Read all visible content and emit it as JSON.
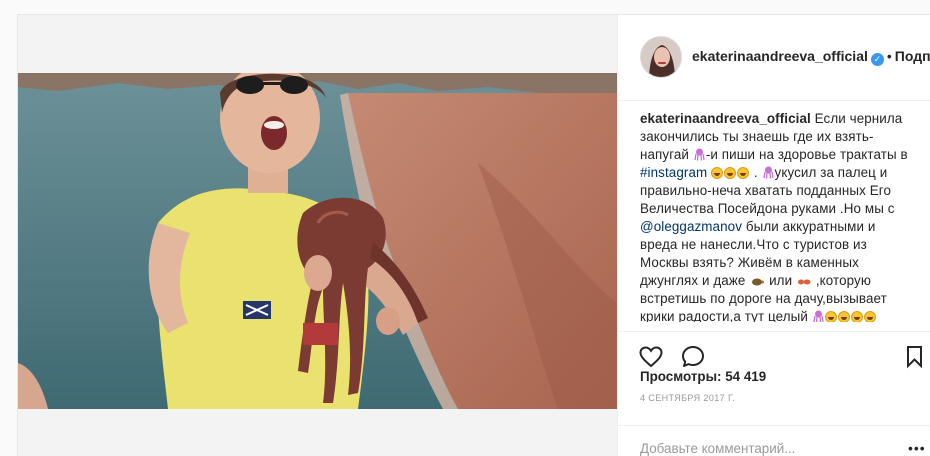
{
  "post": {
    "author": {
      "username": "ekaterinaandreeva_official",
      "verified": true,
      "separator": "•",
      "follow_label": "Подписаться",
      "follow_visible": "Подпи"
    },
    "caption": {
      "username": "ekaterinaandreeva_official",
      "part1": " Если чернила закончились ты знаешь где их взять-напугай ",
      "part2": "-и пиши на здоровье трактаты в ",
      "hashtag": "#instagram",
      "part3": " . ",
      "part4": "укусил за палец и правильно-неча хватать подданных Его Величества Посейдона руками .Но мы с ",
      "mention": "@oleggazmanov",
      "part5": " были аккуратными и вреда не нанесли.Что с туристов из Москвы взять? Живём в каменных джунглях и даже ",
      "part6": " или ",
      "part7": " ,которую встретишь по дороге на дачу,вызывает крики радости,а тут целый "
    },
    "views_label": "Просмотры:",
    "views_value": "54 419",
    "date": "4 СЕНТЯБРЯ 2017 Г.",
    "comment_placeholder": "Добавьте комментарий...",
    "more_label": "•••"
  },
  "icons": {
    "like": "heart-icon",
    "comment": "comment-bubble-icon",
    "save": "bookmark-icon",
    "verified": "verified-badge-icon",
    "octopus": "octopus-emoji-icon",
    "laugh": "laughing-emoji-icon",
    "turtle": "turtle-emoji-icon",
    "ant": "ant-emoji-icon"
  },
  "colors": {
    "link": "#003569",
    "verified": "#3897f0",
    "muted": "#999999",
    "border": "#efefef"
  }
}
